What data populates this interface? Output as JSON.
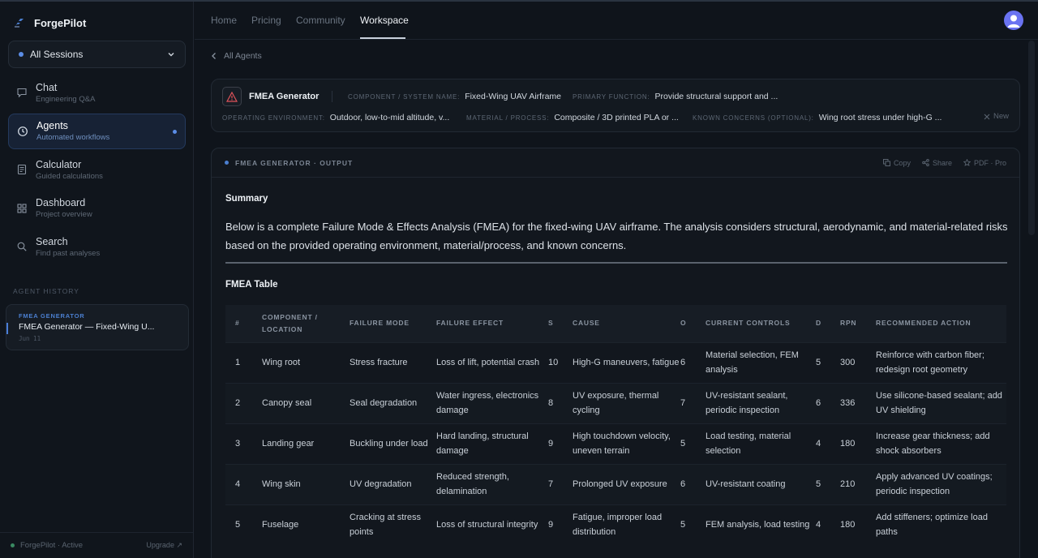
{
  "app": {
    "brand": "ForgePilot",
    "session_select": "All Sessions"
  },
  "nav": [
    {
      "title": "Chat",
      "subtitle": "Engineering Q&A",
      "icon": "chat-icon"
    },
    {
      "title": "Agents",
      "subtitle": "Automated workflows",
      "icon": "clock-icon",
      "active": true
    },
    {
      "title": "Calculator",
      "subtitle": "Guided calculations",
      "icon": "calculator-icon"
    },
    {
      "title": "Dashboard",
      "subtitle": "Project overview",
      "icon": "grid-icon"
    },
    {
      "title": "Search",
      "subtitle": "Find past analyses",
      "icon": "search-icon"
    }
  ],
  "history": {
    "label": "AGENT HISTORY",
    "item": {
      "tag": "FMEA GENERATOR",
      "title": "FMEA Generator — Fixed-Wing U...",
      "date": "Jun 11"
    }
  },
  "footer": {
    "status": "ForgePilot · Active",
    "upgrade": "Upgrade ↗"
  },
  "topnav": {
    "tabs": [
      "Home",
      "Pricing",
      "Community",
      "Workspace"
    ],
    "active": "Workspace"
  },
  "back_label": "All Agents",
  "config": {
    "name": "FMEA Generator",
    "fields": {
      "component": {
        "label": "COMPONENT / SYSTEM NAME:",
        "value": "Fixed-Wing UAV Airframe"
      },
      "function": {
        "label": "PRIMARY FUNCTION:",
        "value": "Provide structural support and ..."
      },
      "environment": {
        "label": "OPERATING ENVIRONMENT:",
        "value": "Outdoor, low-to-mid altitude, v..."
      },
      "material": {
        "label": "MATERIAL / PROCESS:",
        "value": "Composite / 3D printed PLA or ..."
      },
      "concerns": {
        "label": "KNOWN CONCERNS (OPTIONAL):",
        "value": "Wing root stress under high-G ..."
      }
    },
    "new_label": "New"
  },
  "output": {
    "title": "FMEA GENERATOR · OUTPUT",
    "actions": {
      "copy": "Copy",
      "share": "Share",
      "pdf": "PDF · Pro"
    },
    "summary_heading": "Summary",
    "summary_text": "Below is a complete Failure Mode & Effects Analysis (FMEA) for the fixed-wing UAV airframe. The analysis considers structural, aerodynamic, and material-related risks based on the provided operating environment, material/process, and known concerns.",
    "table_heading": "FMEA Table",
    "columns": [
      "#",
      "COMPONENT / LOCATION",
      "FAILURE MODE",
      "FAILURE EFFECT",
      "S",
      "CAUSE",
      "O",
      "CURRENT CONTROLS",
      "D",
      "RPN",
      "RECOMMENDED ACTION"
    ],
    "rows": [
      [
        "1",
        "Wing root",
        "Stress fracture",
        "Loss of lift, potential crash",
        "10",
        "High-G maneuvers, fatigue",
        "6",
        "Material selection, FEM analysis",
        "5",
        "300",
        "Reinforce with carbon fiber; redesign root geometry"
      ],
      [
        "2",
        "Canopy seal",
        "Seal degradation",
        "Water ingress, electronics damage",
        "8",
        "UV exposure, thermal cycling",
        "7",
        "UV-resistant sealant, periodic inspection",
        "6",
        "336",
        "Use silicone-based sealant; add UV shielding"
      ],
      [
        "3",
        "Landing gear",
        "Buckling under load",
        "Hard landing, structural damage",
        "9",
        "High touchdown velocity, uneven terrain",
        "5",
        "Load testing, material selection",
        "4",
        "180",
        "Increase gear thickness; add shock absorbers"
      ],
      [
        "4",
        "Wing skin",
        "UV degradation",
        "Reduced strength, delamination",
        "7",
        "Prolonged UV exposure",
        "6",
        "UV-resistant coating",
        "5",
        "210",
        "Apply advanced UV coatings; periodic inspection"
      ],
      [
        "5",
        "Fuselage",
        "Cracking at stress points",
        "Loss of structural integrity",
        "9",
        "Fatigue, improper load distribution",
        "5",
        "FEM analysis, load testing",
        "4",
        "180",
        "Add stiffeners; optimize load paths"
      ]
    ]
  },
  "colors": {
    "accent": "#5b8de6",
    "background": "#0f141b",
    "panel": "#131920"
  }
}
